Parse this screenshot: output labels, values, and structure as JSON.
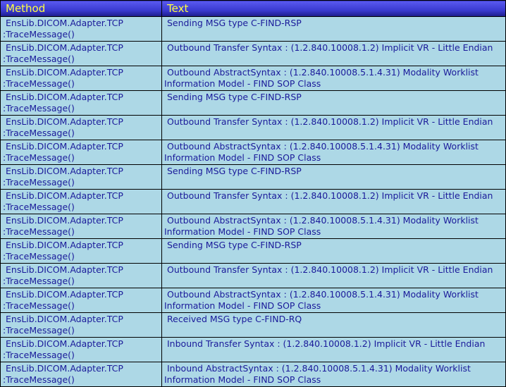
{
  "table": {
    "headers": {
      "method": "Method",
      "text": "Text"
    },
    "rows": [
      {
        "method": [
          "EnsLib.DICOM.Adapter.TCP",
          ":TraceMessage()"
        ],
        "text": [
          "Sending MSG type C-FIND-RSP",
          ""
        ]
      },
      {
        "method": [
          "EnsLib.DICOM.Adapter.TCP",
          ":TraceMessage()"
        ],
        "text": [
          "Outbound Transfer Syntax : (1.2.840.10008.1.2) Implicit VR - Little Endian",
          ""
        ]
      },
      {
        "method": [
          "EnsLib.DICOM.Adapter.TCP",
          ":TraceMessage()"
        ],
        "text": [
          "Outbound AbstractSyntax : (1.2.840.10008.5.1.4.31) Modality Worklist",
          "Information Model - FIND SOP Class"
        ]
      },
      {
        "method": [
          "EnsLib.DICOM.Adapter.TCP",
          ":TraceMessage()"
        ],
        "text": [
          "Sending MSG type C-FIND-RSP",
          ""
        ]
      },
      {
        "method": [
          "EnsLib.DICOM.Adapter.TCP",
          ":TraceMessage()"
        ],
        "text": [
          "Outbound Transfer Syntax : (1.2.840.10008.1.2) Implicit VR - Little Endian",
          ""
        ]
      },
      {
        "method": [
          "EnsLib.DICOM.Adapter.TCP",
          ":TraceMessage()"
        ],
        "text": [
          "Outbound AbstractSyntax : (1.2.840.10008.5.1.4.31) Modality Worklist",
          "Information Model - FIND SOP Class"
        ]
      },
      {
        "method": [
          "EnsLib.DICOM.Adapter.TCP",
          ":TraceMessage()"
        ],
        "text": [
          "Sending MSG type C-FIND-RSP",
          ""
        ]
      },
      {
        "method": [
          "EnsLib.DICOM.Adapter.TCP",
          ":TraceMessage()"
        ],
        "text": [
          "Outbound Transfer Syntax : (1.2.840.10008.1.2) Implicit VR - Little Endian",
          ""
        ]
      },
      {
        "method": [
          "EnsLib.DICOM.Adapter.TCP",
          ":TraceMessage()"
        ],
        "text": [
          "Outbound AbstractSyntax : (1.2.840.10008.5.1.4.31) Modality Worklist",
          "Information Model - FIND SOP Class"
        ]
      },
      {
        "method": [
          "EnsLib.DICOM.Adapter.TCP",
          ":TraceMessage()"
        ],
        "text": [
          "Sending MSG type C-FIND-RSP",
          ""
        ]
      },
      {
        "method": [
          "EnsLib.DICOM.Adapter.TCP",
          ":TraceMessage()"
        ],
        "text": [
          "Outbound Transfer Syntax : (1.2.840.10008.1.2) Implicit VR - Little Endian",
          ""
        ]
      },
      {
        "method": [
          "EnsLib.DICOM.Adapter.TCP",
          ":TraceMessage()"
        ],
        "text": [
          "Outbound AbstractSyntax : (1.2.840.10008.5.1.4.31) Modality Worklist",
          "Information Model - FIND SOP Class"
        ]
      },
      {
        "method": [
          "EnsLib.DICOM.Adapter.TCP",
          ":TraceMessage()"
        ],
        "text": [
          "Received MSG type C-FIND-RQ",
          ""
        ]
      },
      {
        "method": [
          "EnsLib.DICOM.Adapter.TCP",
          ":TraceMessage()"
        ],
        "text": [
          "Inbound Transfer Syntax : (1.2.840.10008.1.2) Implicit VR - Little Endian",
          ""
        ]
      },
      {
        "method": [
          "EnsLib.DICOM.Adapter.TCP",
          ":TraceMessage()"
        ],
        "text": [
          "Inbound AbstractSyntax : (1.2.840.10008.5.1.4.31) Modality Worklist",
          "Information Model - FIND SOP Class"
        ]
      }
    ]
  }
}
